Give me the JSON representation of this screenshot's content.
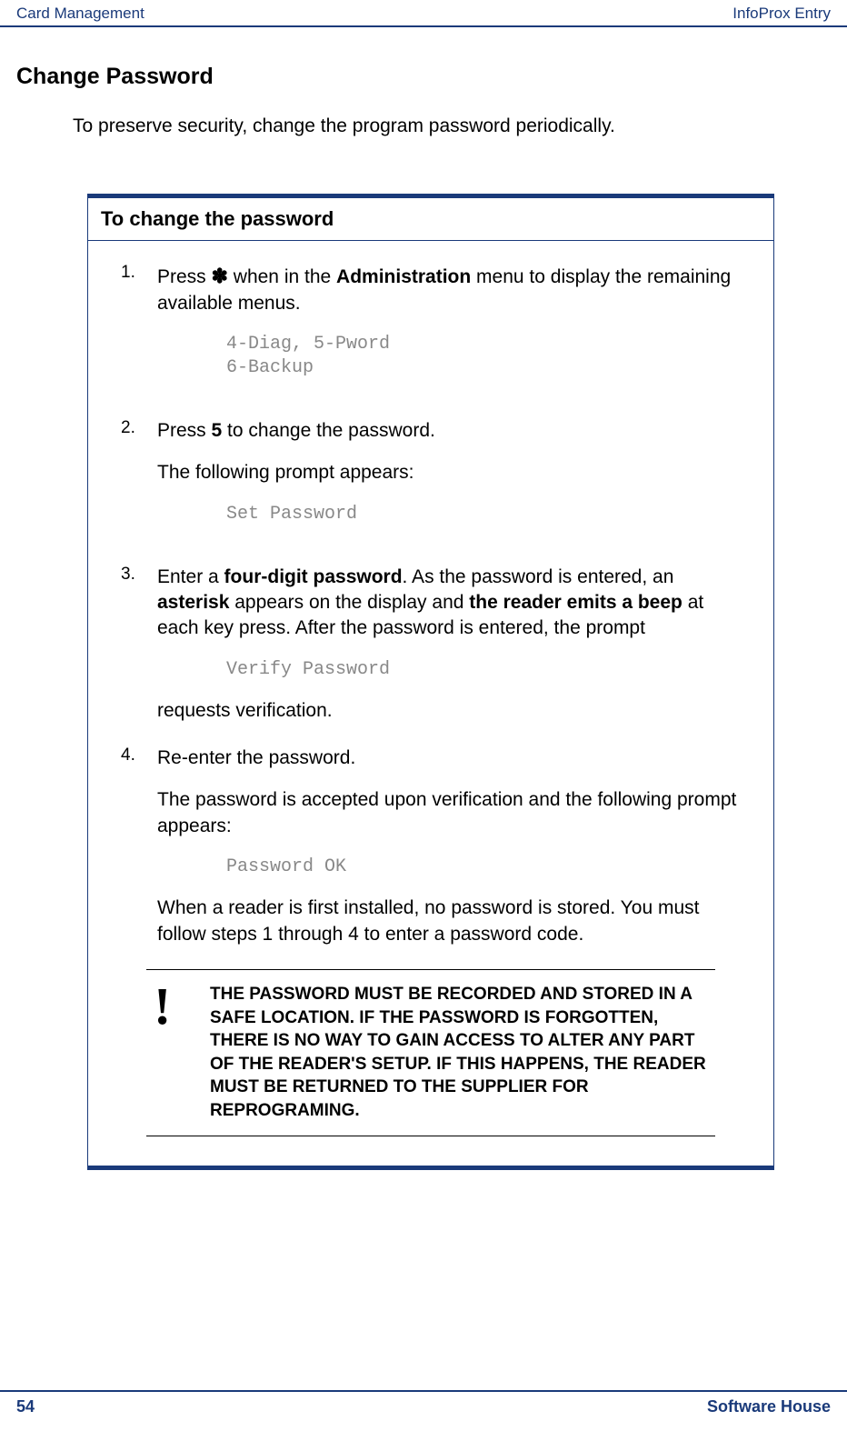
{
  "header": {
    "left": "Card Management",
    "right": "InfoProx Entry"
  },
  "section_title": "Change Password",
  "intro": "To preserve security, change the program password periodically.",
  "box": {
    "title": "To change the password",
    "steps": [
      {
        "num": "1.",
        "text_before": "Press ",
        "star": "✽",
        "text_mid": " when in the ",
        "bold1": "Administration",
        "text_after": " menu to display the remaining available menus.",
        "code": "4-Diag, 5-Pword\n6-Backup"
      },
      {
        "num": "2.",
        "text1": "Press ",
        "bold1": "5",
        "text_after": " to change the password.",
        "para2": "The following prompt appears:",
        "code": "Set Password"
      },
      {
        "num": "3.",
        "text1": "Enter a ",
        "bold1": "four-digit password",
        "text2": ". As the password is entered, an ",
        "bold2": "asterisk",
        "text3": " appears on the display and ",
        "bold3": "the reader emits a beep",
        "text4": " at each key press. After the password is entered, the prompt",
        "code": "Verify Password",
        "after_code": "requests verification."
      },
      {
        "num": "4.",
        "para1": "Re-enter the password.",
        "para2": "The password is accepted upon verification and the following prompt appears:",
        "code": "Password OK",
        "para3": "When a reader is first installed, no password is stored. You must follow steps 1 through 4 to enter a password code."
      }
    ],
    "warning": {
      "icon": "!",
      "text": "THE PASSWORD MUST BE RECORDED AND STORED IN A SAFE LOCATION. IF THE PASSWORD IS FORGOTTEN, THERE IS NO WAY TO GAIN ACCESS TO ALTER ANY PART OF THE READER'S SETUP. IF THIS HAPPENS, THE READER MUST BE RETURNED TO THE SUPPLIER FOR REPROGRAMING."
    }
  },
  "footer": {
    "page": "54",
    "right": "Software House"
  }
}
